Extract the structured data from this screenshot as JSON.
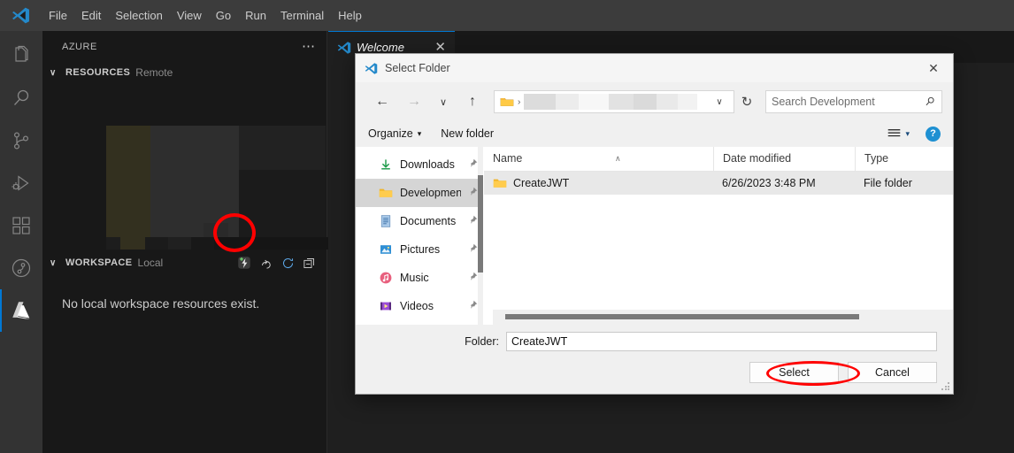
{
  "app": {
    "menu": [
      "File",
      "Edit",
      "Selection",
      "View",
      "Go",
      "Run",
      "Terminal",
      "Help"
    ],
    "logo_icon": "vscode-logo-icon"
  },
  "activitybar": {
    "items": [
      {
        "name": "explorer",
        "icon": "files-icon",
        "active": false
      },
      {
        "name": "search",
        "icon": "search-icon",
        "active": false
      },
      {
        "name": "source-control",
        "icon": "source-control-icon",
        "active": false
      },
      {
        "name": "run-and-debug",
        "icon": "run-debug-icon",
        "active": false
      },
      {
        "name": "extensions",
        "icon": "extensions-icon",
        "active": false
      },
      {
        "name": "azure-pipelines",
        "icon": "circle-branch-icon",
        "active": false
      },
      {
        "name": "azure",
        "icon": "azure-logo-icon",
        "active": true
      }
    ]
  },
  "sidebar": {
    "title": "AZURE",
    "more_icon": "more-actions-icon",
    "resources": {
      "label": "RESOURCES",
      "sub": "Remote",
      "chevron": "∨"
    },
    "workspace": {
      "label": "WORKSPACE",
      "sub": "Local",
      "chevron": "∨",
      "empty_message": "No local workspace resources exist.",
      "actions": [
        {
          "name": "create-function-icon",
          "title": "Create Function"
        },
        {
          "name": "deploy-icon",
          "title": "Deploy"
        },
        {
          "name": "refresh-icon",
          "title": "Refresh"
        },
        {
          "name": "collapse-all-icon",
          "title": "Collapse All"
        }
      ]
    }
  },
  "editor": {
    "tabs": [
      {
        "label": "Welcome",
        "icon": "vscode-logo-icon",
        "close_icon": "✕",
        "active": true
      }
    ]
  },
  "dialog": {
    "title": "Select Folder",
    "title_icon": "vscode-logo-icon",
    "close_icon": "✕",
    "nav": {
      "back_icon": "←",
      "forward_icon": "→",
      "recent_icon": "∨",
      "up_icon": "↑",
      "folder_icon": "folder-icon",
      "crumb_separator": "›",
      "dropdown_icon": "∨",
      "refresh_icon": "↻"
    },
    "search": {
      "placeholder": "Search Development",
      "value": "",
      "icon": "search-icon"
    },
    "commandbar": {
      "organize": "Organize",
      "organize_caret": "▾",
      "new_folder": "New folder",
      "view_icon": "view-options-icon",
      "view_caret": "▾",
      "help_label": "?"
    },
    "tree": {
      "items": [
        {
          "label": "Downloads",
          "icon": "downloads-icon",
          "pinned": true,
          "selected": false
        },
        {
          "label": "Development",
          "icon": "folder-icon",
          "pinned": true,
          "selected": true
        },
        {
          "label": "Documents",
          "icon": "documents-icon",
          "pinned": true,
          "selected": false
        },
        {
          "label": "Pictures",
          "icon": "pictures-icon",
          "pinned": true,
          "selected": false
        },
        {
          "label": "Music",
          "icon": "music-icon",
          "pinned": true,
          "selected": false
        },
        {
          "label": "Videos",
          "icon": "videos-icon",
          "pinned": true,
          "selected": false
        }
      ],
      "pin_glyph": "📌"
    },
    "filelist": {
      "columns": [
        "Name",
        "Date modified",
        "Type"
      ],
      "sort_caret": "∧",
      "rows": [
        {
          "name": "CreateJWT",
          "date_modified": "6/26/2023 3:48 PM",
          "type": "File folder",
          "icon": "folder-icon",
          "selected": true
        }
      ]
    },
    "footer": {
      "folder_label": "Folder:",
      "folder_value": "CreateJWT",
      "select_button": "Select",
      "cancel_button": "Cancel"
    }
  },
  "annotations": {
    "accent_color": "#ff0000",
    "items": [
      {
        "name": "highlight-create-function-icon",
        "shape": "ellipse"
      },
      {
        "name": "highlight-select-button",
        "shape": "ellipse"
      }
    ]
  }
}
